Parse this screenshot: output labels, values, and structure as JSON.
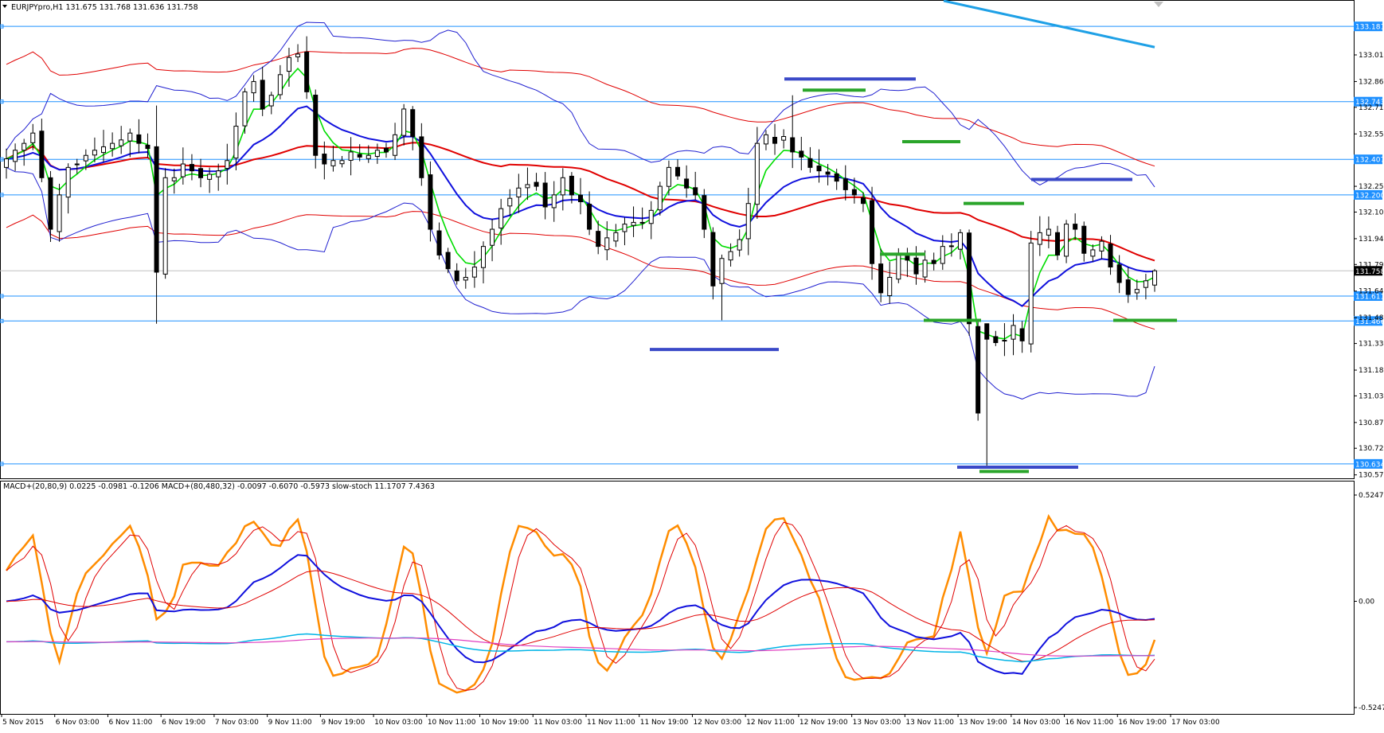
{
  "main_chart": {
    "header": "EURJPYpro,H1  131.675 131.768 131.636 131.758",
    "price_axis_ticks": [
      "133.015",
      "132.860",
      "132.710",
      "132.555",
      "132.250",
      "132.100",
      "131.945",
      "131.795",
      "131.640",
      "131.485",
      "131.335",
      "131.180",
      "131.030",
      "130.875",
      "130.725",
      "130.570"
    ],
    "current_price": "131.758",
    "horizontal_levels": [
      {
        "label": "133.181",
        "value": 133.181
      },
      {
        "label": "132.743",
        "value": 132.743
      },
      {
        "label": "132.407",
        "value": 132.407
      },
      {
        "label": "132.200",
        "value": 132.2
      },
      {
        "label": "131.611",
        "value": 131.611
      },
      {
        "label": "131.466",
        "value": 131.466
      },
      {
        "label": "130.634",
        "value": 130.634
      }
    ]
  },
  "indicator_panel": {
    "header": "MACD+(20,80,9) 0.0225 -0.0981 -0.1206  MACD+(80,480,32) -0.0097 -0.6070 -0.5973  slow-stoch 11.1707 7.4363",
    "axis_ticks": [
      "0.5247",
      "0.00",
      "-0.5247"
    ]
  },
  "time_axis": [
    "5 Nov 2015",
    "6 Nov 03:00",
    "6 Nov 11:00",
    "6 Nov 19:00",
    "7 Nov 03:00",
    "9 Nov 11:00",
    "9 Nov 19:00",
    "10 Nov 03:00",
    "10 Nov 11:00",
    "10 Nov 19:00",
    "11 Nov 03:00",
    "11 Nov 11:00",
    "11 Nov 19:00",
    "12 Nov 03:00",
    "12 Nov 11:00",
    "12 Nov 19:00",
    "13 Nov 03:00",
    "13 Nov 11:00",
    "13 Nov 19:00",
    "14 Nov 03:00",
    "16 Nov 11:00",
    "16 Nov 19:00",
    "17 Nov 03:00"
  ],
  "chart_data": [
    {
      "type": "candlestick",
      "title": "EURJPYpro,H1",
      "ylim": [
        130.55,
        133.33
      ],
      "price_ohlc_last": {
        "open": 131.675,
        "high": 131.768,
        "low": 131.636,
        "close": 131.758
      },
      "series": [
        {
          "name": "close (approx.)",
          "values": [
            132.41,
            132.46,
            132.5,
            132.56,
            132.3,
            132.0,
            132.2,
            132.36,
            132.38,
            132.43,
            132.46,
            132.48,
            132.5,
            132.52,
            132.56,
            132.5,
            132.47,
            131.75,
            132.3,
            132.3,
            132.38,
            132.34,
            132.3,
            132.32,
            132.34,
            132.4,
            132.6,
            132.8,
            132.86,
            132.7,
            132.78,
            132.9,
            133.0,
            133.02,
            132.8,
            132.43,
            132.38,
            132.4,
            132.4,
            132.45,
            132.42,
            132.43,
            132.46,
            132.45,
            132.55,
            132.7,
            132.54,
            132.3,
            132.0,
            131.85,
            131.77,
            131.7,
            131.72,
            131.78,
            131.9,
            132.0,
            132.12,
            132.18,
            132.24,
            132.26,
            132.25,
            132.13,
            132.2,
            132.3,
            132.2,
            132.16,
            132.0,
            131.9,
            131.95,
            131.98,
            132.03,
            132.04,
            132.04,
            132.11,
            132.25,
            132.36,
            132.31,
            132.24,
            132.2,
            132.0,
            131.67,
            131.83,
            131.87,
            131.94,
            132.15,
            132.5,
            132.55,
            132.5,
            132.54,
            132.45,
            132.42,
            132.36,
            132.34,
            132.32,
            132.28,
            132.23,
            132.2,
            132.15,
            131.8,
            131.63,
            131.72,
            131.85,
            131.82,
            131.74,
            131.82,
            131.8,
            131.9,
            131.9,
            131.98,
            131.45,
            130.93,
            131.36,
            131.34,
            131.35,
            131.44,
            131.35,
            131.92,
            131.98,
            132.0,
            131.85,
            132.03,
            132.0,
            131.86,
            131.88,
            131.93,
            131.78,
            131.69,
            131.62,
            131.65,
            131.7,
            131.76
          ]
        }
      ],
      "overlays": [
        "Bollinger Bands (blue)",
        "Moving Average (red)",
        "Moving Average (green)",
        "Moving Average (blue)",
        "Resistance/Support markers"
      ]
    },
    {
      "type": "line",
      "title": "MACD+ / slow-stoch",
      "ylim": [
        -0.5247,
        0.5247
      ],
      "series": [
        {
          "name": "MACD+(20,80,9)",
          "values": [
            0.0225,
            -0.0981,
            -0.1206
          ]
        },
        {
          "name": "MACD+(80,480,32)",
          "values": [
            -0.0097,
            -0.607,
            -0.5973
          ]
        },
        {
          "name": "slow-stoch",
          "values": [
            11.1707,
            7.4363
          ]
        }
      ]
    }
  ],
  "colors": {
    "grid_level": "#1e90ff",
    "up_candle": "#ffffff",
    "down_candle": "#000000",
    "bollinger": "#2020d0",
    "ma_red": "#e00000",
    "ma_green": "#00dd00",
    "ma_blue": "#1010dd",
    "trend_line": "#1ea0e6",
    "marker_blue": "#3a49c8",
    "marker_green": "#2aa52a",
    "stoch_orange": "#ff8c00",
    "macd_cyan": "#00b4e6",
    "macd_magenta": "#e040c0"
  }
}
